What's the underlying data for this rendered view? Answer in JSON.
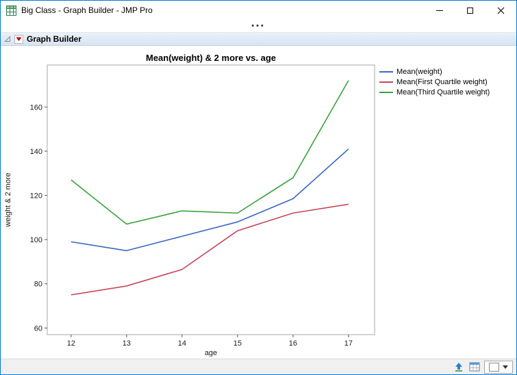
{
  "window": {
    "title": "Big Class - Graph Builder - JMP Pro"
  },
  "toolbar": {
    "dots": "•••"
  },
  "outline": {
    "title": "Graph Builder"
  },
  "chart_data": {
    "type": "line",
    "title": "Mean(weight) & 2 more vs. age",
    "xlabel": "age",
    "ylabel": "weight & 2 more",
    "x": [
      12,
      13,
      14,
      15,
      16,
      17
    ],
    "series": [
      {
        "name": "Mean(weight)",
        "color": "#3a66c4",
        "values": [
          99,
          95,
          101.5,
          108,
          118.5,
          141
        ]
      },
      {
        "name": "Mean(First Quartile weight)",
        "color": "#c4465a",
        "values": [
          75,
          79,
          86.5,
          104,
          112,
          116
        ]
      },
      {
        "name": "Mean(Third Quartile weight)",
        "color": "#38a03c",
        "values": [
          127,
          107,
          113,
          112,
          128,
          172
        ]
      }
    ],
    "xlim": [
      11.57,
      17.47
    ],
    "ylim": [
      57,
      179
    ],
    "xticks": [
      12,
      13,
      14,
      15,
      16,
      17
    ],
    "yticks": [
      60,
      80,
      100,
      120,
      140,
      160
    ],
    "grid": false,
    "legend_position": "right"
  },
  "colors": {
    "window_border": "#0078d7",
    "plot_border": "#a6a6a6",
    "tick_color": "#555555",
    "text_color": "#1a1a1a"
  }
}
